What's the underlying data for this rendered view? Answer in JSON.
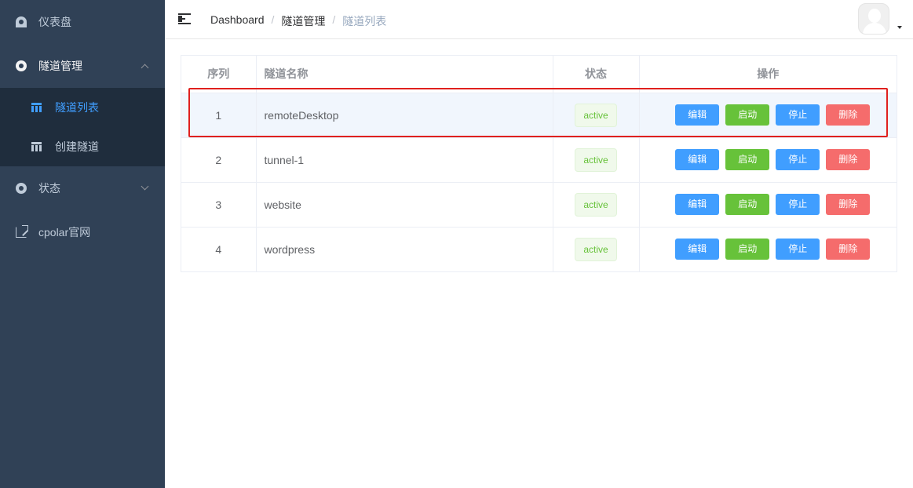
{
  "sidebar": {
    "items": [
      {
        "label": "仪表盘",
        "icon": "dashboard-icon"
      },
      {
        "label": "隧道管理",
        "icon": "tunnel-icon",
        "expanded": true,
        "children": [
          {
            "label": "隧道列表",
            "icon": "grid-icon",
            "active": true
          },
          {
            "label": "创建隧道",
            "icon": "grid-icon",
            "active": false
          }
        ]
      },
      {
        "label": "状态",
        "icon": "status-icon",
        "expanded": false
      },
      {
        "label": "cpolar官网",
        "icon": "external-link-icon"
      }
    ]
  },
  "header": {
    "breadcrumb": [
      "Dashboard",
      "隧道管理",
      "隧道列表"
    ],
    "separator": "/"
  },
  "table": {
    "columns": [
      "序列",
      "隧道名称",
      "状态",
      "操作"
    ],
    "rows": [
      {
        "index": "1",
        "name": "remoteDesktop",
        "status": "active"
      },
      {
        "index": "2",
        "name": "tunnel-1",
        "status": "active"
      },
      {
        "index": "3",
        "name": "website",
        "status": "active"
      },
      {
        "index": "4",
        "name": "wordpress",
        "status": "active"
      }
    ],
    "actions": {
      "edit": "编辑",
      "start": "启动",
      "stop": "停止",
      "delete": "删除"
    }
  },
  "colors": {
    "sidebar_bg": "#304156",
    "submenu_bg": "#1f2d3d",
    "primary": "#409eff",
    "success": "#67c23a",
    "danger": "#f56c6c",
    "highlight": "#e0201e"
  }
}
